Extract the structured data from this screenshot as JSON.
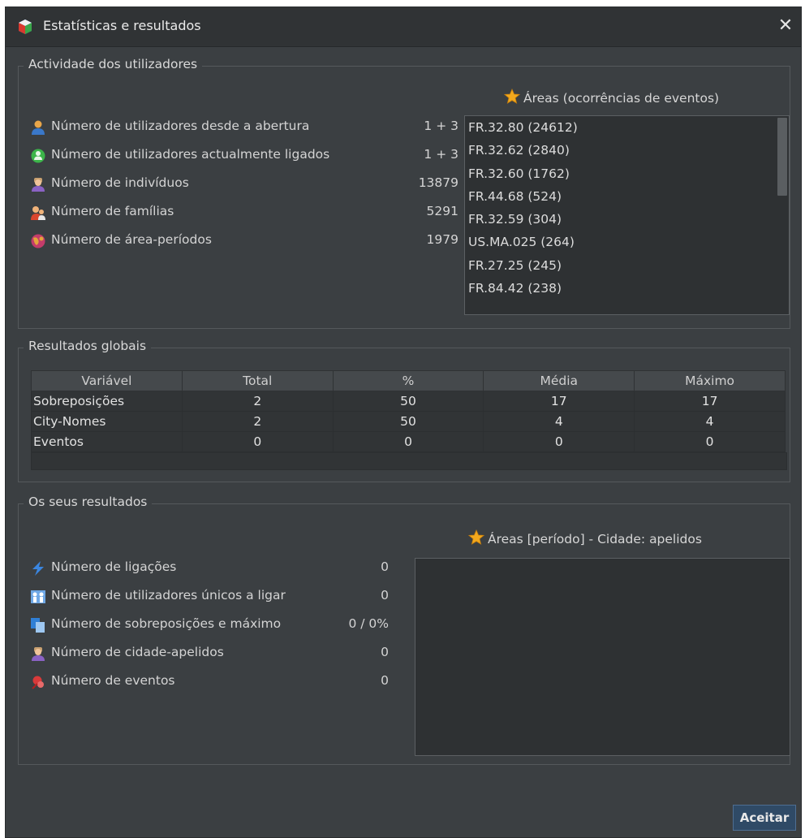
{
  "window": {
    "title": "Estatísticas e resultados",
    "close_symbol": "✕"
  },
  "activity": {
    "title": "Actividade dos utilizadores",
    "rows": [
      {
        "icon": "user-icon",
        "label": "Número de utilizadores desde a abertura",
        "value": "1 + 3"
      },
      {
        "icon": "connected-users-icon",
        "label": "Número de utilizadores actualmente ligados",
        "value": "1 + 3"
      },
      {
        "icon": "individual-icon",
        "label": "Número de indivíduos",
        "value": "13879"
      },
      {
        "icon": "family-icon",
        "label": "Número de famílias",
        "value": "5291"
      },
      {
        "icon": "globe-icon",
        "label": "Número de área-períodos",
        "value": "1979"
      }
    ],
    "areas_title": "Áreas (ocorrências de eventos)",
    "areas": [
      "FR.32.80 (24612)",
      "FR.32.62 (2840)",
      "FR.32.60 (1762)",
      "FR.44.68 (524)",
      "FR.32.59 (304)",
      "US.MA.025 (264)",
      "FR.27.25 (245)",
      "FR.84.42 (238)"
    ]
  },
  "global": {
    "title": "Resultados globais",
    "columns": [
      "Variável",
      "Total",
      "%",
      "Média",
      "Máximo"
    ],
    "rows": [
      [
        "Sobreposições",
        "2",
        "50",
        "17",
        "17"
      ],
      [
        "City-Nomes",
        "2",
        "50",
        "4",
        "4"
      ],
      [
        "Eventos",
        "0",
        "0",
        "0",
        "0"
      ]
    ]
  },
  "yours": {
    "title": "Os seus resultados",
    "rows": [
      {
        "icon": "lightning-icon",
        "label": "Número de ligações",
        "value": "0"
      },
      {
        "icon": "unique-users-icon",
        "label": "Número de utilizadores únicos a ligar",
        "value": "0"
      },
      {
        "icon": "overlap-icon",
        "label": "Número de sobreposições e máximo",
        "value": "0 / 0%"
      },
      {
        "icon": "city-surname-icon",
        "label": "Número de cidade-apelidos",
        "value": "0"
      },
      {
        "icon": "events-icon",
        "label": "Número de eventos",
        "value": "0"
      }
    ],
    "areas_title": "Áreas [período] - Cidade: apelidos",
    "areas": []
  },
  "footer": {
    "ok_label": "Aceitar"
  },
  "colors": {
    "background": "#3b3f42",
    "titlebar": "#303335",
    "accent_button": "#2f4a66"
  }
}
